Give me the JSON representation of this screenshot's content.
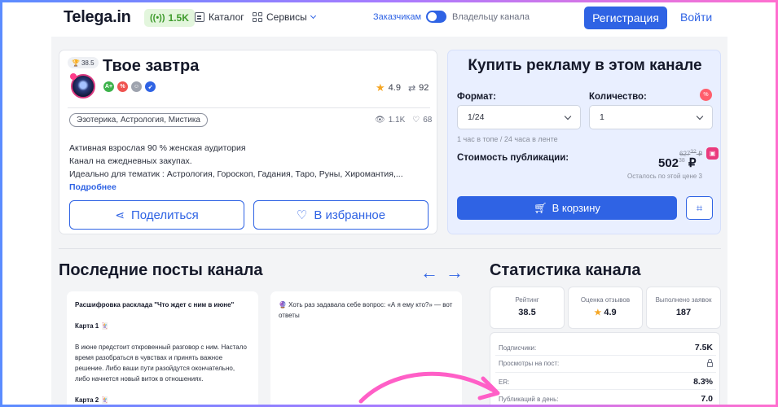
{
  "header": {
    "logo": "Telega.in",
    "online_count": "1.5K",
    "nav": {
      "catalog": "Каталог",
      "services": "Сервисы"
    },
    "toggle": {
      "left_label": "Заказчикам",
      "right_label": "Владельцу канала"
    },
    "register_label": "Регистрация",
    "login_label": "Войти"
  },
  "channel": {
    "subscribers_chip": "38.5",
    "title": "Твое завтра",
    "badges": [
      "A+",
      "%",
      "",
      ""
    ],
    "rating": "4.9",
    "reposts": "92",
    "tags": "Эзотерика, Астрология, Мистика",
    "views": "1.1K",
    "likes": "68",
    "description": [
      "Активная взрослая 90 % женская аудитория",
      "Канал на ежедневных закупах.",
      "Идеально для тематик : Астрология, Гороскоп, Гадания, Таро, Руны, Хиромантия,..."
    ],
    "more_link": "Подробнее",
    "share_label": "Поделиться",
    "favorite_label": "В избранное"
  },
  "buy": {
    "title": "Купить рекламу в этом канале",
    "format_label": "Формат:",
    "format_value": "1/24",
    "quantity_label": "Количество:",
    "quantity_value": "1",
    "format_hint": "1 час в топе / 24 часа в ленте",
    "price_label": "Стоимость публикации:",
    "old_price": "627",
    "old_price_cents": "32",
    "old_price_currency": "₽",
    "new_price": "502",
    "new_price_cents": "38",
    "new_price_currency": "₽",
    "remaining_note": "Осталось по этой цене 3",
    "cart_label": "В корзину",
    "discount_badge": "%"
  },
  "posts": {
    "title": "Последние посты канала",
    "items": [
      {
        "heading": "Расшифровка расклада \"Что ждет с ним в июне\"",
        "card1": "Карта 1 🃏",
        "body": "В июне предстоит откровенный разговор с ним. Настало время разобраться в чувствах и принять важное решение. Либо ваши пути разойдутся окончательно, либо начнется новый виток в отношениях.",
        "card2": "Карта 2 🃏"
      },
      {
        "body": "🔮 Хоть раз задавала себе вопрос: «А я ему кто?» — вот ответы"
      }
    ]
  },
  "stats": {
    "title": "Статистика канала",
    "boxes": [
      {
        "label": "Рейтинг",
        "value": "38.5"
      },
      {
        "label": "Оценка отзывов",
        "value": "4.9"
      },
      {
        "label": "Выполнено заявок",
        "value": "187"
      }
    ],
    "rows": [
      {
        "label": "Подписчики:",
        "value": "7.5K"
      },
      {
        "label": "Просмотры на пост:",
        "value": ""
      },
      {
        "label": "ER:",
        "value": "8.3%"
      },
      {
        "label": "Публикаций в день:",
        "value": "7.0"
      }
    ]
  },
  "colors": {
    "accent": "#2f63e4",
    "pink": "#ea3a7d",
    "online_green": "#3e9b2c"
  }
}
